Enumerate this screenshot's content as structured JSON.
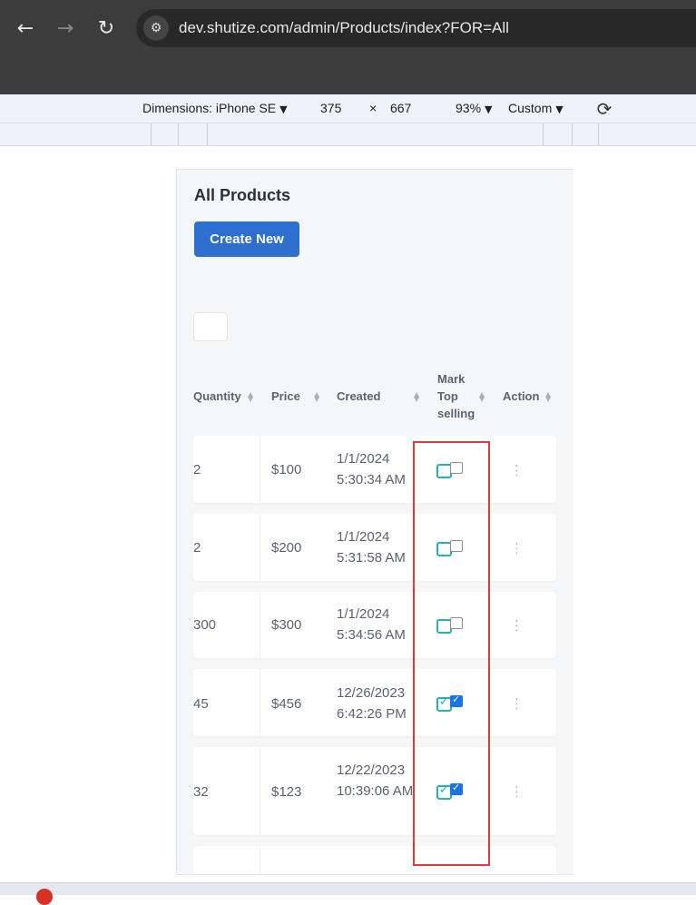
{
  "browser": {
    "back_icon": "←",
    "forward_icon": "→",
    "reload_icon": "↻",
    "site_icon": "⚙",
    "url": "dev.shutize.com/admin/Products/index?FOR=All"
  },
  "devtools": {
    "dimensions": "Dimensions: iPhone SE",
    "width": "375",
    "times": "×",
    "height": "667",
    "zoom": "93%",
    "throttle": "Custom",
    "caret": "▼",
    "rotate_icon": "⟳"
  },
  "page": {
    "title": "All Products",
    "create_label": "Create New"
  },
  "table": {
    "headers": {
      "quantity": "Quantity",
      "price": "Price",
      "created": "Created",
      "mark_top_selling": "Mark Top selling",
      "action": "Action"
    },
    "sort_icon": "▲▼",
    "action_icon": "⋮",
    "rows": [
      {
        "quantity": "2",
        "price": "$100",
        "created": "1/1/2024 5:30:34 AM",
        "top_selling": false
      },
      {
        "quantity": "2",
        "price": "$200",
        "created": "1/1/2024 5:31:58 AM",
        "top_selling": false
      },
      {
        "quantity": "300",
        "price": "$300",
        "created": "1/1/2024 5:34:56 AM",
        "top_selling": false
      },
      {
        "quantity": "45",
        "price": "$456",
        "created": "12/26/2023 6:42:26 PM",
        "top_selling": true
      },
      {
        "quantity": "32",
        "price": "$123",
        "created": "12/22/2023 10:39:06 AM",
        "top_selling": true
      }
    ]
  },
  "colors": {
    "primary_button": "#2d6ecf",
    "toggle_border": "#22b5a8",
    "checkbox_checked": "#1a73e8",
    "highlight_box": "#e0393e"
  }
}
